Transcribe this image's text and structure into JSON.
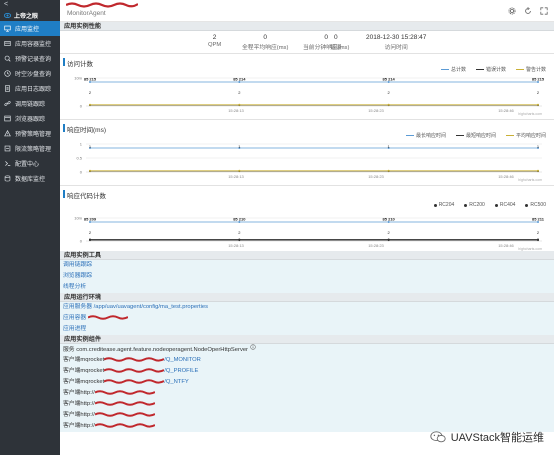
{
  "app": {
    "title": "MonitorAgent",
    "brand": "UAVStack智能运维",
    "accent_color": "#1f7ec5",
    "sidebar_bg": "#2e3339"
  },
  "sidebar": {
    "toggle": "<",
    "head": "上帝之眼",
    "items": [
      {
        "label": "应用监控",
        "icon": "monitor-icon",
        "active": true
      },
      {
        "label": "应用容器监控",
        "icon": "container-icon"
      },
      {
        "label": "预警记录查询",
        "icon": "alert-search-icon"
      },
      {
        "label": "时空沙盘查询",
        "icon": "sandbox-icon"
      },
      {
        "label": "应用日志跟踪",
        "icon": "log-icon"
      },
      {
        "label": "调用链跟踪",
        "icon": "link-icon"
      },
      {
        "label": "浏览器跟踪",
        "icon": "browser-icon"
      },
      {
        "label": "预警策略管理",
        "icon": "policy-icon"
      },
      {
        "label": "限流策略管理",
        "icon": "throttle-icon"
      },
      {
        "label": "配置中心",
        "icon": "config-icon"
      },
      {
        "label": "数据库监控",
        "icon": "database-icon"
      }
    ]
  },
  "toolbar": {
    "icons": [
      "gear-icon",
      "refresh-icon",
      "expand-icon"
    ]
  },
  "performance": {
    "title": "应用实例性能",
    "metrics": [
      {
        "value": "2",
        "label": "QPM"
      },
      {
        "value": "0",
        "label": "全程平均响应(ms)"
      },
      {
        "value": "0",
        "label": "当前分钟响应(ms)"
      },
      {
        "value": "0",
        "label": "错误"
      },
      {
        "value": "2018-12-30 15:28:47",
        "label": "访问时间"
      }
    ]
  },
  "charts": [
    {
      "id": "visits",
      "title": "访问计数",
      "legend": [
        {
          "name": "总计数",
          "color": "#5b9bd5"
        },
        {
          "name": "错误计数",
          "color": "#333333"
        },
        {
          "name": "警告计数",
          "color": "#c9b036"
        }
      ],
      "y_top_label": "10m",
      "y_bottom_label": "0",
      "point_labels": [
        "2",
        "2",
        "2",
        "2"
      ],
      "point_tops": [
        "85 215",
        "85 214",
        "85 214",
        "85 215"
      ],
      "x_labels": [
        "15:28:13",
        "15:28:23",
        "15:28:46"
      ],
      "source": "highcharts.com",
      "chart_data": {
        "type": "line",
        "x": [
          "15:28:13",
          "15:28:23",
          "15:28:46"
        ],
        "series": [
          {
            "name": "总计数",
            "values": [
              2,
              2,
              2,
              2
            ]
          },
          {
            "name": "错误计数",
            "values": [
              0,
              0,
              0,
              0
            ]
          },
          {
            "name": "警告计数",
            "values": [
              0,
              0,
              0,
              0
            ]
          }
        ]
      }
    },
    {
      "id": "response",
      "title": "响应时间(ms)",
      "legend": [
        {
          "name": "最长响应时间",
          "color": "#5b9bd5"
        },
        {
          "name": "最短响应时间",
          "color": "#333333"
        },
        {
          "name": "平均响应时间",
          "color": "#c9b036"
        }
      ],
      "y_top_label": "1",
      "y_mid_label": "0.5",
      "y_bottom_label": "0",
      "point_labels": [
        "1",
        "1",
        "1",
        "1"
      ],
      "x_labels": [
        "15:28:13",
        "15:28:23",
        "15:28:46"
      ],
      "source": "highcharts.com",
      "chart_data": {
        "type": "line",
        "x": [
          "15:28:13",
          "15:28:23",
          "15:28:46"
        ],
        "series": [
          {
            "name": "最长响应时间",
            "values": [
              1,
              1,
              1,
              1
            ]
          },
          {
            "name": "最短响应时间",
            "values": [
              0,
              0,
              0,
              0
            ]
          },
          {
            "name": "平均响应时间",
            "values": [
              0,
              0,
              0,
              0
            ]
          }
        ]
      }
    },
    {
      "id": "codes",
      "title": "响应代码计数",
      "legend": [
        {
          "name": "RC204",
          "color": "#333333"
        },
        {
          "name": "RC200",
          "color": "#333333"
        },
        {
          "name": "RC404",
          "color": "#333333"
        },
        {
          "name": "RC500",
          "color": "#333333"
        }
      ],
      "y_top_label": "10m",
      "y_bottom_label": "0",
      "point_labels": [
        "2",
        "2",
        "2",
        "2"
      ],
      "point_tops": [
        "85 209",
        "85 210",
        "85 210",
        "85 211"
      ],
      "x_labels": [
        "15:28:13",
        "15:28:23",
        "15:28:46"
      ],
      "source": "highcharts.com",
      "chart_data": {
        "type": "line",
        "x": [
          "15:28:13",
          "15:28:23",
          "15:28:46"
        ],
        "series": [
          {
            "name": "RC200",
            "values": [
              2,
              2,
              2,
              2
            ]
          },
          {
            "name": "RC204",
            "values": [
              0,
              0,
              0,
              0
            ]
          },
          {
            "name": "RC404",
            "values": [
              0,
              0,
              0,
              0
            ]
          },
          {
            "name": "RC500",
            "values": [
              0,
              0,
              0,
              0
            ]
          }
        ]
      }
    }
  ],
  "tools": {
    "title": "应用实例工具",
    "items": [
      "调用链跟踪",
      "浏览器跟踪",
      "线程分析"
    ]
  },
  "env": {
    "title": "应用运行环境",
    "server_label": "应用服务器",
    "server_path": "/app/uav/uavagent/config/ma_test.properties",
    "container_label": "应用容器",
    "process_label": "应用进程"
  },
  "components": {
    "title": "应用实例组件",
    "service_label": "服务",
    "service_value": "com.creditease.agent.feature.nodeoperagent.NodeOperHttpServer",
    "clients": [
      {
        "label": "客户端",
        "value": "mqrocket",
        "suffix": "/Q_MONITOR"
      },
      {
        "label": "客户端",
        "value": "mqrocket",
        "suffix": "/Q_PROFILE"
      },
      {
        "label": "客户端",
        "value": "mqrocket",
        "suffix": "/Q_NTFY"
      },
      {
        "label": "客户端",
        "value": "http://",
        "suffix": ""
      },
      {
        "label": "客户端",
        "value": "http://",
        "suffix": ""
      },
      {
        "label": "客户端",
        "value": "http://",
        "suffix": ""
      },
      {
        "label": "客户端",
        "value": "http://",
        "suffix": ""
      }
    ]
  }
}
